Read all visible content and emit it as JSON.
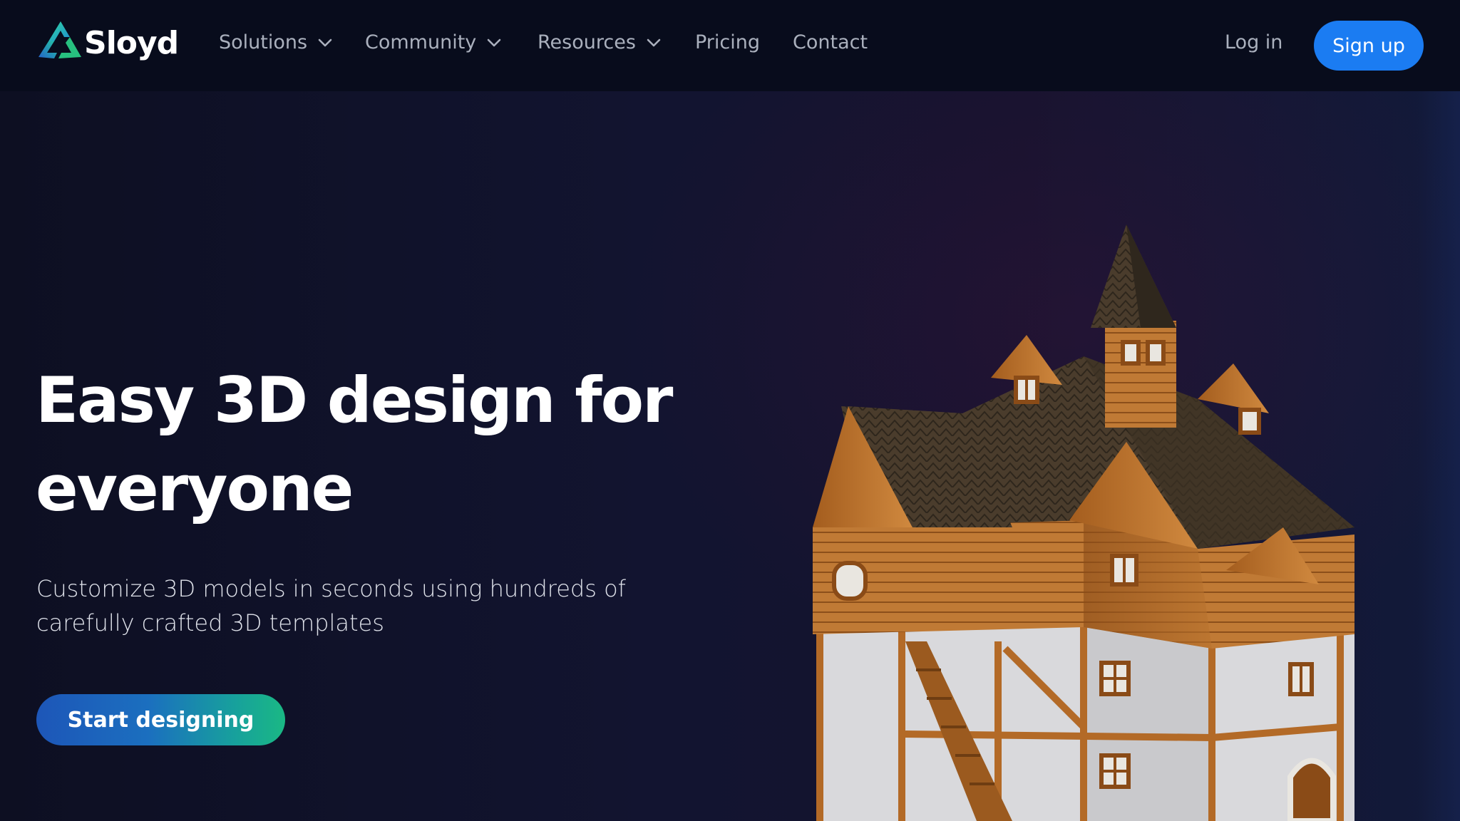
{
  "brand": {
    "name": "Sloyd",
    "logo_icon": "sloyd-triangle-logo-icon"
  },
  "nav": {
    "items": [
      {
        "label": "Solutions",
        "has_dropdown": true
      },
      {
        "label": "Community",
        "has_dropdown": true
      },
      {
        "label": "Resources",
        "has_dropdown": true
      },
      {
        "label": "Pricing",
        "has_dropdown": false
      },
      {
        "label": "Contact",
        "has_dropdown": false
      }
    ],
    "login_label": "Log in",
    "signup_label": "Sign up"
  },
  "hero": {
    "title_line1": "Easy 3D design for",
    "title_line2": "everyone",
    "subtitle_line1": "Customize 3D models in seconds using hundreds of",
    "subtitle_line2": "carefully crafted 3D templates",
    "cta_label": "Start designing",
    "image": "3d-medieval-house-model"
  },
  "colors": {
    "nav_bg": "#080c1c",
    "page_bg": "#0f1126",
    "accent_blue": "#1b7cf2",
    "cta_gradient_start": "#1d56b8",
    "cta_gradient_end": "#1ab884",
    "nav_text": "#aab0bd"
  }
}
